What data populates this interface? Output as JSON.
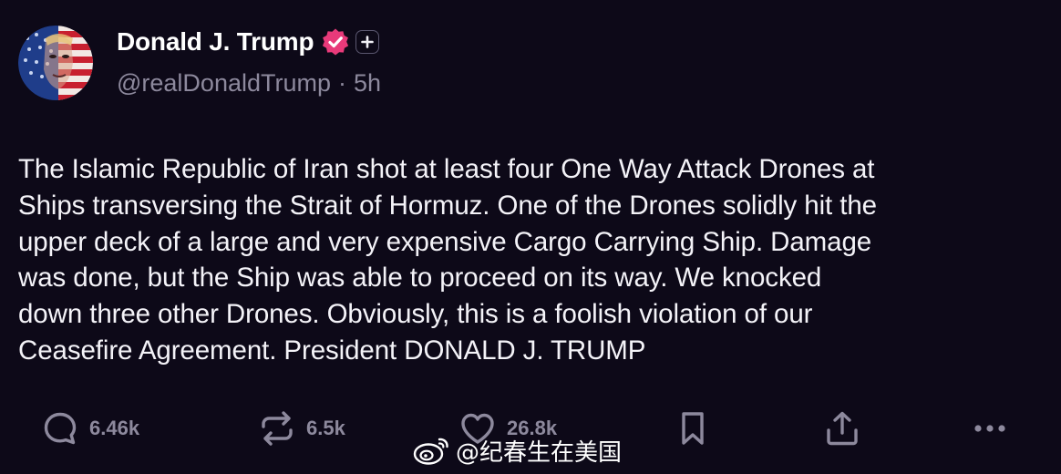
{
  "author": {
    "display_name": "Donald J. Trump",
    "handle": "@realDonaldTrump",
    "separator": "·",
    "time": "5h",
    "avatar_icon": "flag-portrait-avatar",
    "verified_icon": "verified-badge-icon",
    "plus_icon": "plus-badge-icon"
  },
  "post": {
    "lines": [
      "The Islamic Republic of Iran shot at least four One Way Attack Drones at",
      "Ships transversing the Strait of Hormuz. One of the Drones solidly hit the",
      "upper deck of a large and very expensive Cargo Carrying Ship. Damage",
      "was done, but the Ship was able to proceed on its way. We knocked",
      "down three other Drones. Obviously, this is a foolish violation of our",
      "Ceasefire Agreement. President DONALD J. TRUMP"
    ]
  },
  "actions": {
    "replies": {
      "icon": "reply-bubble-icon",
      "count": "6.46k"
    },
    "reposts": {
      "icon": "repost-arrows-icon",
      "count": "6.5k"
    },
    "likes": {
      "icon": "heart-icon",
      "count": "26.8k"
    },
    "bookmark": {
      "icon": "bookmark-icon"
    },
    "share": {
      "icon": "share-upload-icon"
    },
    "more": {
      "icon": "more-dots-icon"
    }
  },
  "watermark": {
    "icon": "weibo-logo-icon",
    "text": "@纪春生在美国"
  },
  "colors": {
    "background": "#0d0918",
    "text": "#f4f3f8",
    "muted": "#8d899d",
    "verified": "#e83a7a"
  }
}
